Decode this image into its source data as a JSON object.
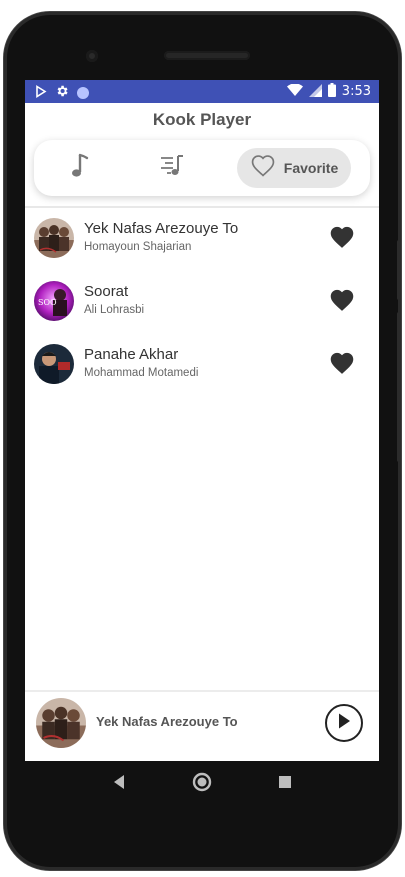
{
  "status_bar": {
    "time": "3:53"
  },
  "app": {
    "title": "Kook Player"
  },
  "tabs": [
    {
      "id": "songs",
      "icon": "music-note-icon"
    },
    {
      "id": "playlist",
      "icon": "playlist-icon"
    },
    {
      "id": "favorite",
      "icon": "heart-outline-icon",
      "label": "Favorite",
      "active": true
    }
  ],
  "songs": [
    {
      "title": "Yek Nafas Arezouye To",
      "artist": "Homayoun Shajarian"
    },
    {
      "title": "Soorat",
      "artist": "Ali Lohrasbi"
    },
    {
      "title": "Panahe Akhar",
      "artist": "Mohammad Motamedi"
    }
  ],
  "now_playing": {
    "title": "Yek Nafas Arezouye To"
  },
  "colors": {
    "status_bar": "#3f51b5",
    "heart": "#333333"
  }
}
